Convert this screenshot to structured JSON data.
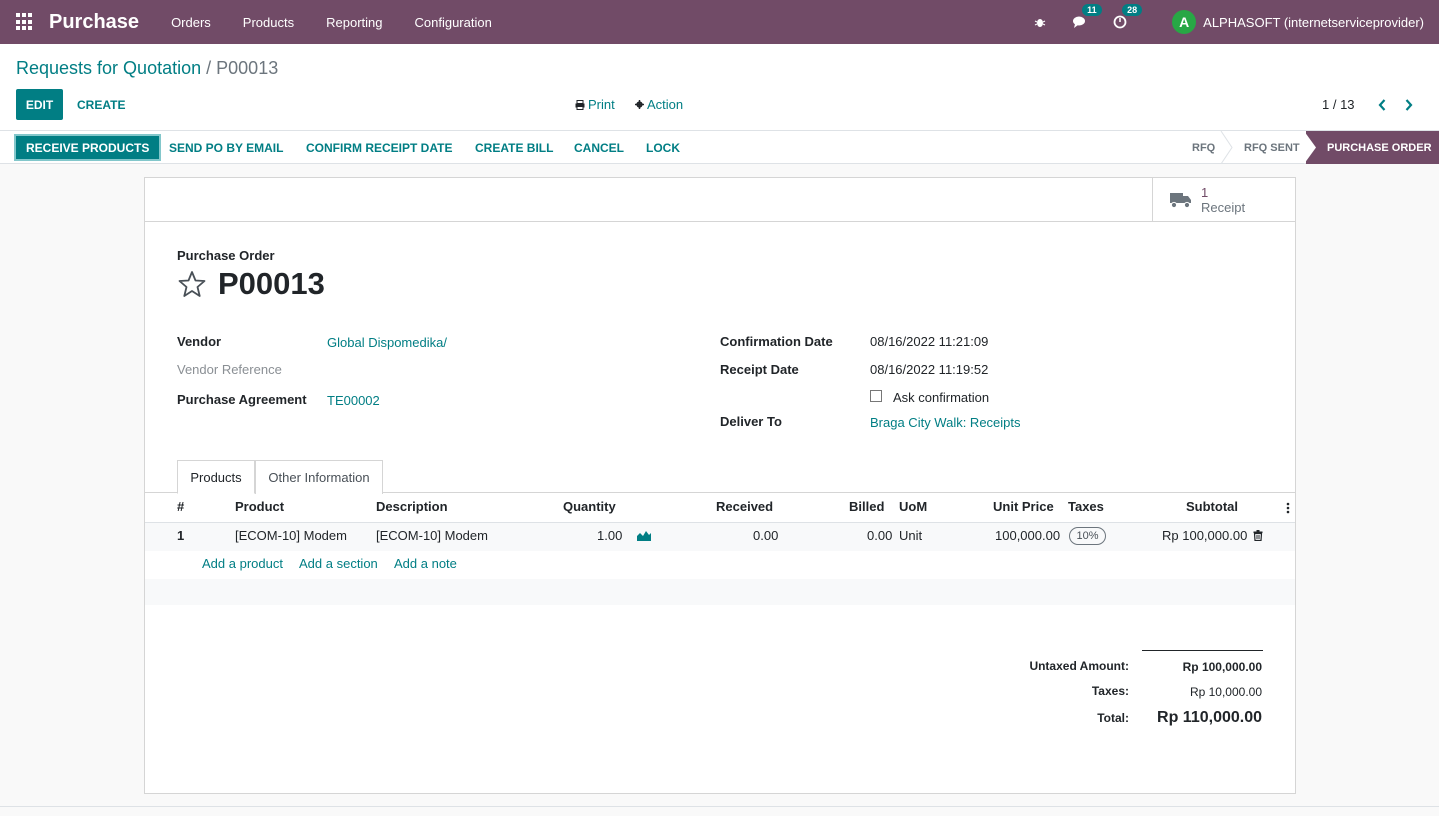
{
  "app": {
    "name": "Purchase",
    "menu": [
      "Orders",
      "Products",
      "Reporting",
      "Configuration"
    ],
    "messages_count": "11",
    "activities_count": "28",
    "user_initial": "A",
    "user_name": "ALPHASOFT (internetserviceprovider)"
  },
  "breadcrumb": {
    "parent": "Requests for Quotation",
    "separator": "/",
    "current": "P00013"
  },
  "control_panel": {
    "edit": "EDIT",
    "create": "CREATE",
    "print": "Print",
    "action": "Action",
    "pager": "1 / 13"
  },
  "statusbar": {
    "buttons": [
      "RECEIVE PRODUCTS",
      "SEND PO BY EMAIL",
      "CONFIRM RECEIPT DATE",
      "CREATE BILL",
      "CANCEL",
      "LOCK"
    ],
    "stages": [
      "RFQ",
      "RFQ SENT",
      "PURCHASE ORDER"
    ],
    "active_stage": "PURCHASE ORDER"
  },
  "smart_button": {
    "count": "1",
    "label": "Receipt"
  },
  "form": {
    "title_label": "Purchase Order",
    "name": "P00013",
    "vendor_label": "Vendor",
    "vendor": "Global Dispomedika/",
    "vendor_ref_label": "Vendor Reference",
    "agreement_label": "Purchase Agreement",
    "agreement": "TE00002",
    "confirmation_label": "Confirmation Date",
    "confirmation_date": "08/16/2022 11:21:09",
    "receipt_label": "Receipt Date",
    "receipt_date": "08/16/2022 11:19:52",
    "ask_confirmation": "Ask confirmation",
    "deliver_label": "Deliver To",
    "deliver_to": "Braga City Walk: Receipts"
  },
  "tabs": [
    "Products",
    "Other Information"
  ],
  "lines": {
    "headers": [
      "#",
      "Product",
      "Description",
      "Quantity",
      "Received",
      "Billed",
      "UoM",
      "Unit Price",
      "Taxes",
      "Subtotal"
    ],
    "rows": [
      {
        "seq": "1",
        "product": "[ECOM-10] Modem",
        "description": "[ECOM-10] Modem",
        "quantity": "1.00",
        "received": "0.00",
        "billed": "0.00",
        "uom": "Unit",
        "unit_price": "100,000.00",
        "taxes": "10%",
        "subtotal": "Rp 100,000.00"
      }
    ],
    "add_product": "Add a product",
    "add_section": "Add a section",
    "add_note": "Add a note"
  },
  "totals": {
    "untaxed_label": "Untaxed Amount:",
    "untaxed": "Rp 100,000.00",
    "taxes_label": "Taxes:",
    "taxes": "Rp 10,000.00",
    "total_label": "Total:",
    "total": "Rp 110,000.00"
  },
  "colors": {
    "brand": "#714B67",
    "accent": "#017e84"
  }
}
